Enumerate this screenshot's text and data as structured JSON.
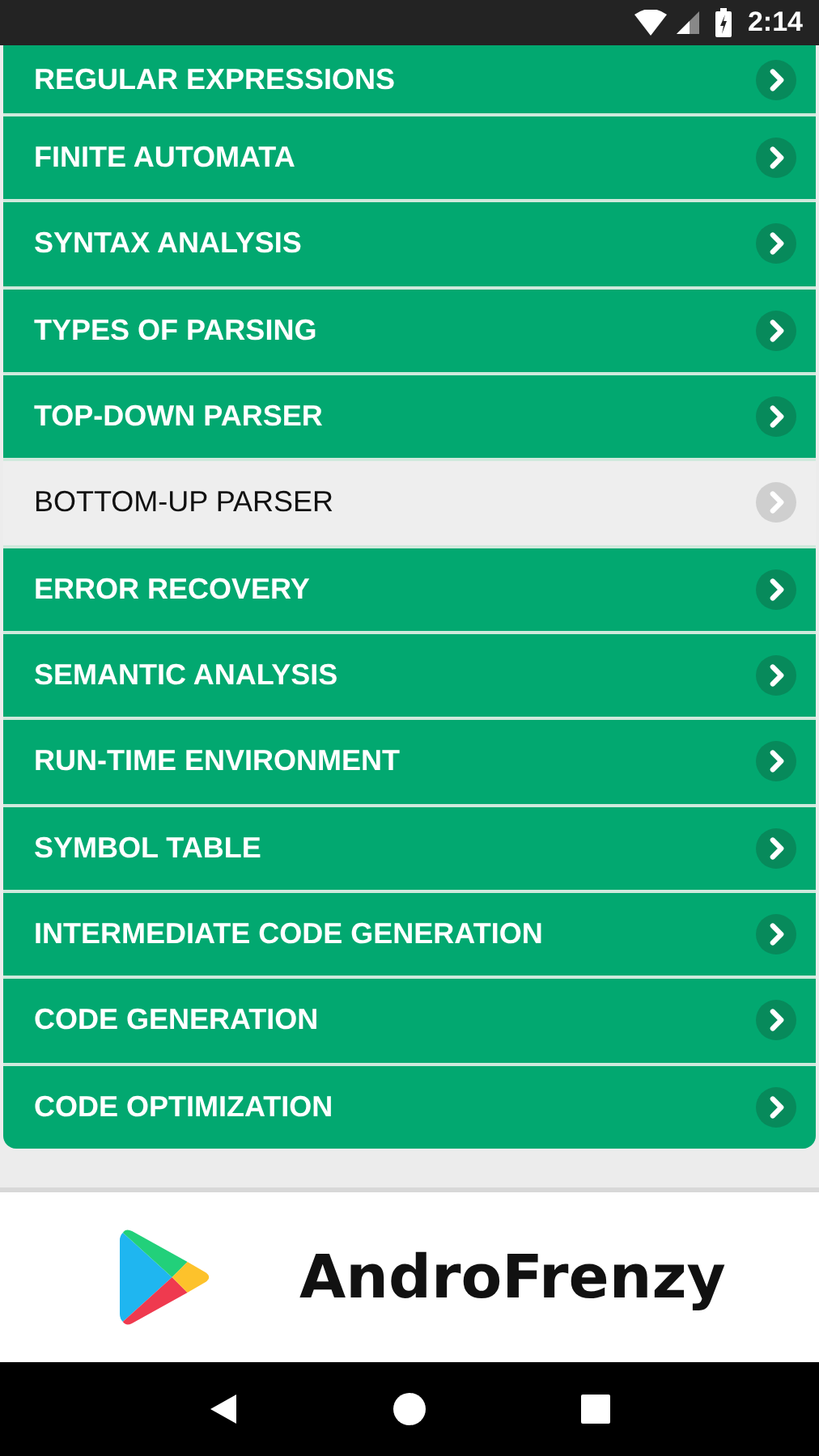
{
  "status_bar": {
    "time": "2:14"
  },
  "topics": [
    {
      "label": "REGULAR EXPRESSIONS",
      "selected": false
    },
    {
      "label": "FINITE AUTOMATA",
      "selected": false
    },
    {
      "label": "SYNTAX ANALYSIS",
      "selected": false
    },
    {
      "label": "TYPES OF PARSING",
      "selected": false
    },
    {
      "label": "TOP-DOWN PARSER",
      "selected": false
    },
    {
      "label": "BOTTOM-UP PARSER",
      "selected": true
    },
    {
      "label": "ERROR RECOVERY",
      "selected": false
    },
    {
      "label": "SEMANTIC ANALYSIS",
      "selected": false
    },
    {
      "label": "RUN-TIME ENVIRONMENT",
      "selected": false
    },
    {
      "label": "SYMBOL TABLE",
      "selected": false
    },
    {
      "label": "INTERMEDIATE CODE GENERATION",
      "selected": false
    },
    {
      "label": "CODE GENERATION",
      "selected": false
    },
    {
      "label": "CODE OPTIMIZATION",
      "selected": false
    }
  ],
  "banner": {
    "brand": "AndroFrenzy"
  }
}
